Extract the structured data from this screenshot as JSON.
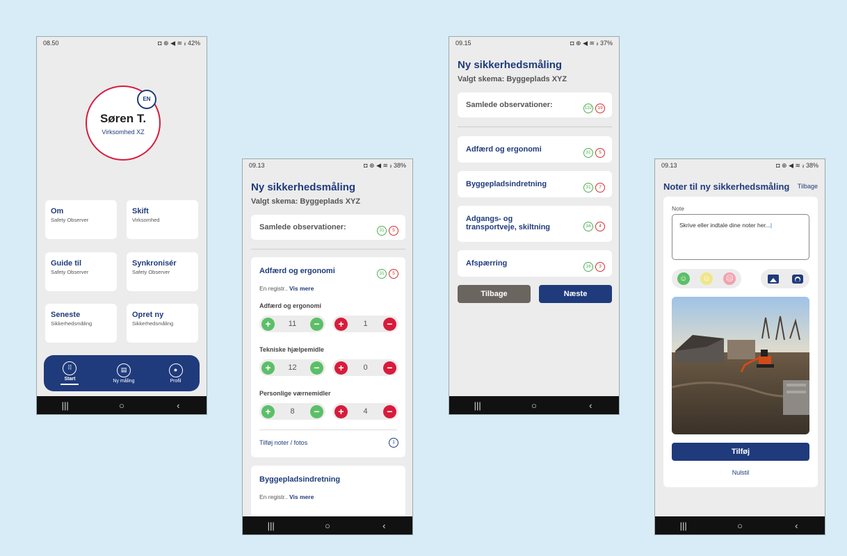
{
  "screen1": {
    "status_time": "08.50",
    "status_icons": "◘ ⊕ ◀ ≋ ᵢₗ 42%",
    "lang_badge": "EN",
    "user_name": "Søren T.",
    "company": "Virksomhed XZ",
    "tiles": [
      {
        "title": "Om",
        "sub": "Safety Observer"
      },
      {
        "title": "Skift",
        "sub": "Virksomhed"
      },
      {
        "title": "Guide til",
        "sub": "Safety Observer"
      },
      {
        "title": "Synkronisér",
        "sub": "Safety Observer"
      },
      {
        "title": "Seneste",
        "sub": "Sikkerhedsmåling"
      },
      {
        "title": "Opret ny",
        "sub": "Sikkerhedsmåling"
      }
    ],
    "bottom_nav": [
      {
        "label": "Start",
        "icon": "grid-icon"
      },
      {
        "label": "Ny måling",
        "icon": "clipboard-icon"
      },
      {
        "label": "Profil",
        "icon": "user-icon"
      }
    ]
  },
  "screen2": {
    "status_time": "09.13",
    "status_icons": "◘ ⊕ ◀ ≋ ᵢₗ 38%",
    "title": "Ny sikkerhedsmåling",
    "schema": "Valgt skema: Byggeplads XYZ",
    "total_label": "Samlede observationer:",
    "total_green": "31",
    "total_red": "5",
    "cat1": {
      "title": "Adfærd og ergonomi",
      "green": "31",
      "red": "5",
      "desc": "En registr..",
      "more": "Vis mere",
      "rows": [
        {
          "label": "Adfærd og ergonomi",
          "pos": "11",
          "neg": "1"
        },
        {
          "label": "Tekniske hjælpemidle",
          "pos": "12",
          "neg": "0"
        },
        {
          "label": "Personlige værnemidler",
          "pos": "8",
          "neg": "4"
        }
      ],
      "notes_label": "Tilføj noter / fotos",
      "notes_count": "1"
    },
    "cat2": {
      "title": "Byggepladsindretning",
      "desc": "En registr..",
      "more": "Vis mere"
    }
  },
  "screen3": {
    "status_time": "09.15",
    "status_icons": "◘ ⊕ ◀ ≋ ᵢₗ 37%",
    "title": "Ny sikkerhedsmåling",
    "schema": "Valgt skema: Byggeplads XYZ",
    "total_label": "Samlede observationer:",
    "total_green": "132",
    "total_red": "19",
    "categories": [
      {
        "title": "Adfærd og ergonomi",
        "green": "31",
        "red": "5"
      },
      {
        "title": "Byggepladsindretning",
        "green": "31",
        "red": "7"
      },
      {
        "title": "Adgangs- og transportveje, skiltning",
        "green": "34",
        "red": "4"
      },
      {
        "title": "Afspærring",
        "green": "16",
        "red": "3"
      }
    ],
    "back_label": "Tilbage",
    "next_label": "Næste"
  },
  "screen4": {
    "status_time": "09.13",
    "status_icons": "◘ ⊕ ◀ ≋ ᵢₗ 38%",
    "title": "Noter til ny sikkerhedsmåling",
    "back_link": "Tilbage",
    "note_label": "Note",
    "note_placeholder": "Skrive eller indtale dine noter her...",
    "add_label": "Tilføj",
    "reset_label": "Nulstil"
  },
  "colors": {
    "primary": "#1f3b7c",
    "positive": "#5cbf68",
    "negative": "#d81b3c",
    "background": "#d7ecf6"
  }
}
